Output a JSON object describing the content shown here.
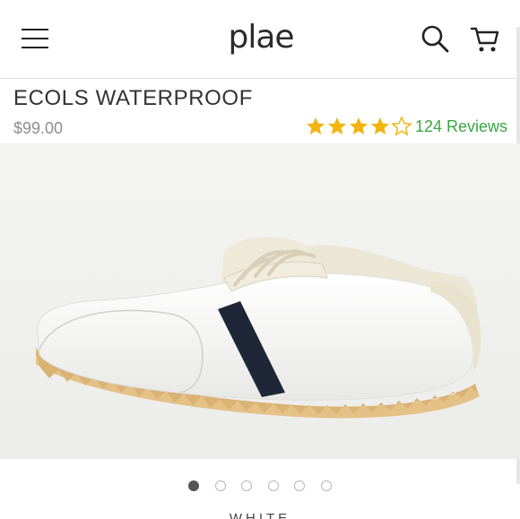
{
  "header": {
    "logo_text": "plae",
    "menu_icon": "hamburger-menu-icon",
    "search_icon": "search-icon",
    "cart_icon": "cart-icon"
  },
  "product": {
    "title": "ECOLS WATERPROOF",
    "price": "$99.00",
    "rating": 4,
    "rating_max": 5,
    "reviews_label": "124 Reviews",
    "color_label": "WHITE"
  },
  "gallery": {
    "image_count": 6,
    "active_index": 0
  },
  "colors": {
    "star": "#f2b40f",
    "reviews_link": "#3ba543",
    "price": "#8e8e8e",
    "title": "#333333"
  }
}
